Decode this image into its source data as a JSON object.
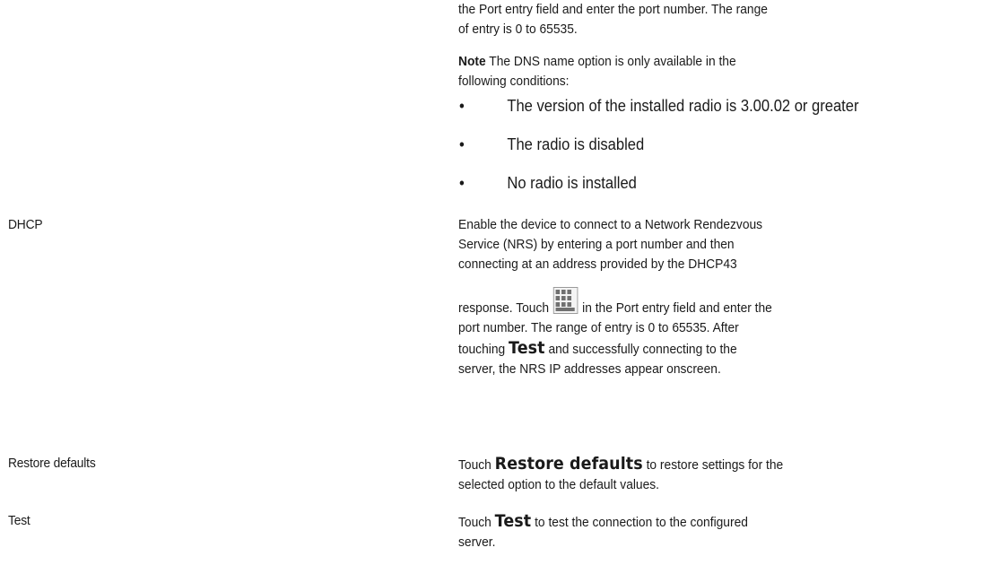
{
  "intro": {
    "line1": "the Port entry field and enter the port number. The range",
    "line2": "of entry is 0 to 65535."
  },
  "note": {
    "label": "Note",
    "text": " The DNS name option is only available in the",
    "text2": "following conditions:"
  },
  "conditions": [
    {
      "bullet": "•",
      "text": "The version of the installed radio is 3.00.02 or greater"
    },
    {
      "bullet": "•",
      "text": "The radio is disabled"
    },
    {
      "bullet": "•",
      "text": "No radio is installed"
    }
  ],
  "rows": {
    "dhcp": {
      "label": "DHCP",
      "line1": "Enable the device to connect to a Network Rendezvous",
      "line2": "Service (NRS) by entering a port number and then",
      "line3": "connecting at an address provided by the DHCP43",
      "line4_pre": "response. Touch ",
      "line4_post": " in the Port entry field and enter the",
      "line5": "port number. The range of entry is 0 to 65535. After",
      "line6_pre": "touching ",
      "line6_bold": "Test",
      "line6_post": " and successfully connecting to the",
      "line7": "server, the NRS IP addresses appear onscreen."
    },
    "restore": {
      "label": "Restore defaults",
      "line1_pre": "Touch ",
      "line1_bold": "Restore defaults",
      "line1_post": " to restore settings for the",
      "line2": "selected option to the default values."
    },
    "test": {
      "label": "Test",
      "line1_pre": "Touch ",
      "line1_bold": "Test",
      "line1_post": " to test the connection to the configured",
      "line2": "server."
    }
  },
  "icons": {
    "keypad": "keypad-icon"
  }
}
